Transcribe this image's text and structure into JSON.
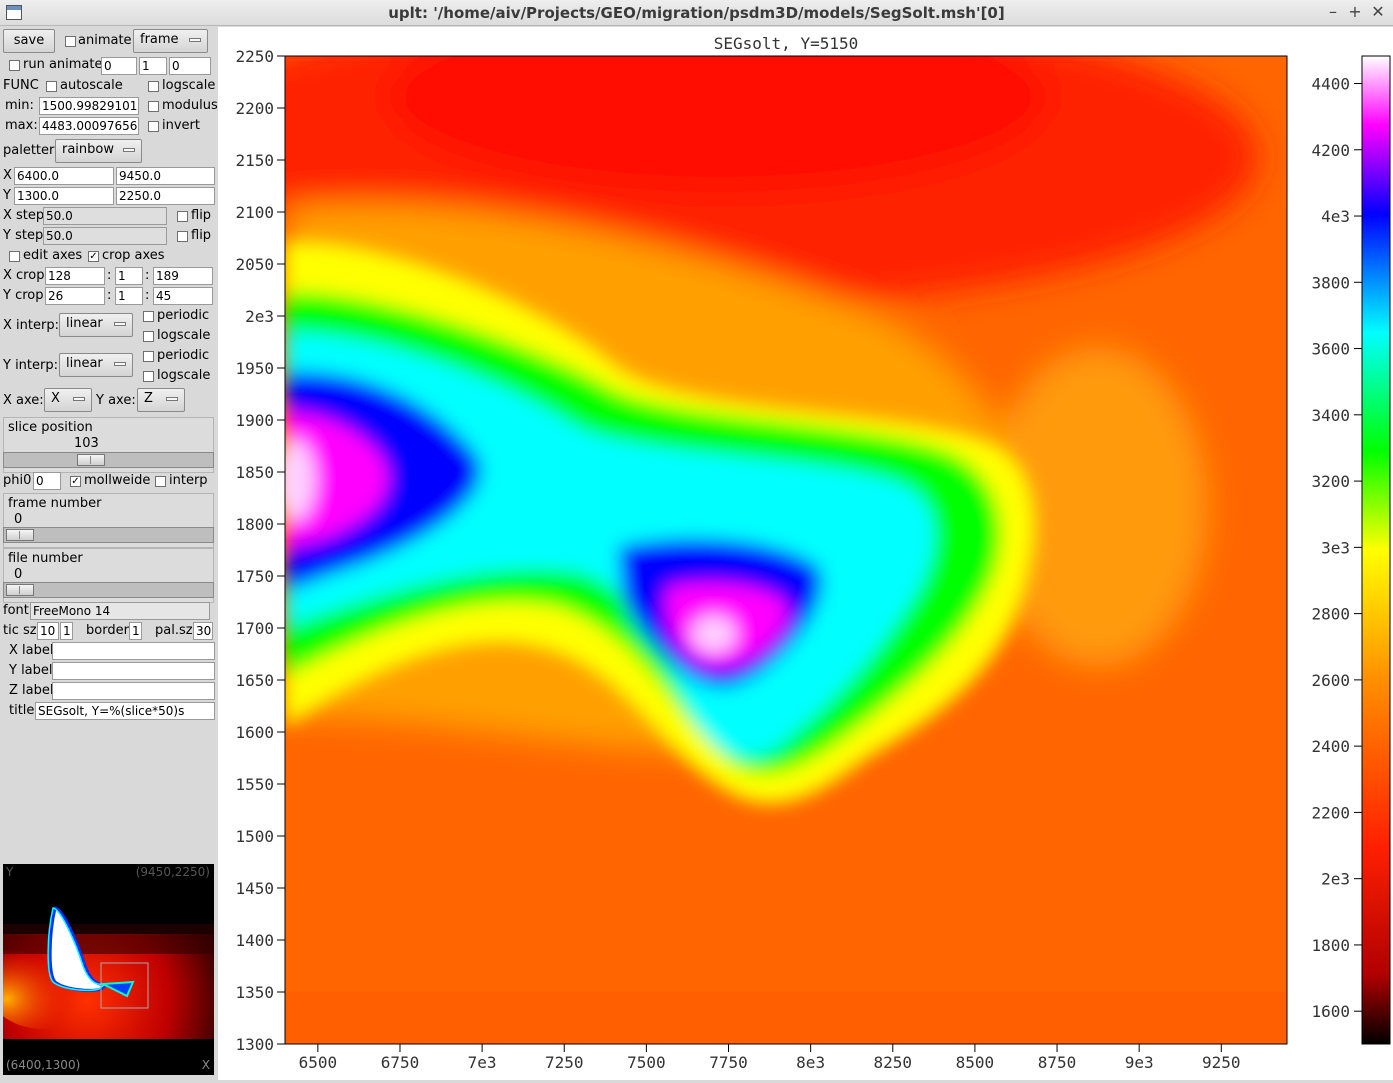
{
  "window": {
    "title": "uplt: '/home/aiv/Projects/GEO/migration/psdm3D/models/SegSolt.msh'[0]",
    "buttons": [
      "–",
      "+",
      "✕"
    ]
  },
  "panel": {
    "save": "save",
    "animate": "animate",
    "frame_mode": "frame",
    "run_animate": "run animate",
    "run_from": "0",
    "run_step": "1",
    "run_to": "0",
    "func": "FUNC",
    "autoscale": "autoscale",
    "logscale": "logscale",
    "min_label": "min:",
    "min_value": "1500.99829101",
    "modulus": "modulus",
    "max_label": "max:",
    "max_value": "4483.00097656",
    "invert": "invert",
    "paletter_label": "paletter",
    "paletter_value": "rainbow",
    "x_label": "X",
    "x_min": "6400.0",
    "x_max": "9450.0",
    "y_label": "Y",
    "y_min": "1300.0",
    "y_max": "2250.0",
    "xstep_label": "X step",
    "xstep_value": "50.0",
    "ystep_label": "Y step",
    "ystep_value": "50.0",
    "flip": "flip",
    "edit_axes": "edit axes",
    "crop_axes": "crop axes",
    "xcrop_label": "X crop",
    "xcrop": [
      "128",
      "1",
      "189"
    ],
    "ycrop_label": "Y crop",
    "ycrop": [
      "26",
      "1",
      "45"
    ],
    "colon": ":",
    "xinterp_label": "X interp:",
    "xinterp_value": "linear",
    "yinterp_label": "Y interp:",
    "yinterp_value": "linear",
    "periodic": "periodic",
    "interp_logscale": "logscale",
    "xaxe_label": "X axe:",
    "xaxe_value": "X",
    "yaxe_label": "Y axe:",
    "yaxe_value": "Z",
    "slice_title": "slice position",
    "slice_value": "103",
    "slice_fraction": 0.4,
    "phi_label": "phi0",
    "phi_value": "0",
    "mollweide": "mollweide",
    "interp": "interp",
    "frame_title": "frame number",
    "frame_value": "0",
    "file_title": "file number",
    "file_value": "0",
    "font_label": "font",
    "font_value": "FreeMono 14",
    "ticsz_label": "tic sz",
    "ticsz_a": "10",
    "ticsz_b": "1",
    "border_label": "border",
    "border_value": "1",
    "palsz_label": "pal.sz",
    "palsz_value": "30",
    "xlabel_label": "X label",
    "ylabel_label": "Y label",
    "zlabel_label": "Z label",
    "title_label": "title",
    "title_value": "SEGsolt, Y=%(slice*50)s"
  },
  "minimap": {
    "top_left": "Y",
    "top_right": "(9450,2250)",
    "bottom_left": "(6400,1300)",
    "bottom_right": "X"
  },
  "chart_data": {
    "type": "heatmap",
    "title": "SEGsolt, Y=5150",
    "xlim": [
      6400,
      9450
    ],
    "ylim": [
      1300,
      2250
    ],
    "x_ticks": [
      "6500",
      "6750",
      "7e3",
      "7250",
      "7500",
      "7750",
      "8e3",
      "8250",
      "8500",
      "8750",
      "9e3",
      "9250"
    ],
    "x_tick_values": [
      6500,
      6750,
      7000,
      7250,
      7500,
      7750,
      8000,
      8250,
      8500,
      8750,
      9000,
      9250
    ],
    "y_ticks": [
      "2250",
      "2200",
      "2150",
      "2100",
      "2050",
      "2e3",
      "1950",
      "1900",
      "1850",
      "1800",
      "1750",
      "1700",
      "1650",
      "1600",
      "1550",
      "1500",
      "1450",
      "1400",
      "1350",
      "1300"
    ],
    "y_tick_values": [
      2250,
      2200,
      2150,
      2100,
      2050,
      2000,
      1950,
      1900,
      1850,
      1800,
      1750,
      1700,
      1650,
      1600,
      1550,
      1500,
      1450,
      1400,
      1350,
      1300
    ],
    "colorbar": {
      "range": [
        1500.998,
        4483.001
      ],
      "palette": "rainbow",
      "ticks": [
        "4400",
        "4200",
        "4e3",
        "3800",
        "3600",
        "3400",
        "3200",
        "3e3",
        "2800",
        "2600",
        "2400",
        "2200",
        "2e3",
        "1800",
        "1600"
      ],
      "tick_values": [
        4400,
        4200,
        4000,
        3800,
        3600,
        3400,
        3200,
        3000,
        2800,
        2600,
        2400,
        2200,
        2000,
        1800,
        1600
      ]
    }
  }
}
